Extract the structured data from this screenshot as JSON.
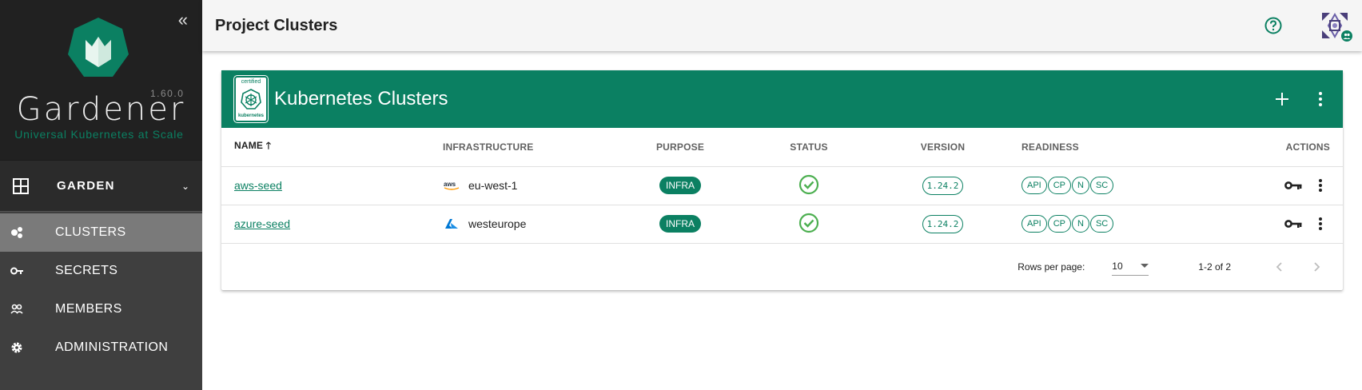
{
  "sidebar": {
    "version": "1.60.0",
    "brand": "Gardener",
    "tagline": "Universal Kubernetes at Scale",
    "project": "GARDEN",
    "items": [
      {
        "label": "CLUSTERS",
        "icon": "clusters-icon",
        "active": true
      },
      {
        "label": "SECRETS",
        "icon": "key-icon"
      },
      {
        "label": "MEMBERS",
        "icon": "members-icon"
      },
      {
        "label": "ADMINISTRATION",
        "icon": "gear-icon"
      }
    ]
  },
  "header": {
    "title": "Project Clusters"
  },
  "card": {
    "title": "Kubernetes Clusters",
    "badge_top": "certified",
    "badge_bottom": "kubernetes",
    "columns": {
      "name": "NAME",
      "infrastructure": "INFRASTRUCTURE",
      "purpose": "PURPOSE",
      "status": "STATUS",
      "version": "VERSION",
      "readiness": "READINESS",
      "actions": "ACTIONS"
    },
    "rows": [
      {
        "name": "aws-seed",
        "provider": "aws",
        "region": "eu-west-1",
        "purpose": "INFRA",
        "version": "1.24.2",
        "readiness": [
          "API",
          "CP",
          "N",
          "SC"
        ]
      },
      {
        "name": "azure-seed",
        "provider": "azure",
        "region": "westeurope",
        "purpose": "INFRA",
        "version": "1.24.2",
        "readiness": [
          "API",
          "CP",
          "N",
          "SC"
        ]
      }
    ],
    "footer": {
      "rows_per_page_label": "Rows per page:",
      "rows_per_page": "10",
      "range": "1-2 of 2"
    }
  },
  "colors": {
    "accent": "#0b8062",
    "sidebar": "#3f3f3f",
    "sidebar_top": "#212121",
    "status_ok": "#4caf50"
  }
}
